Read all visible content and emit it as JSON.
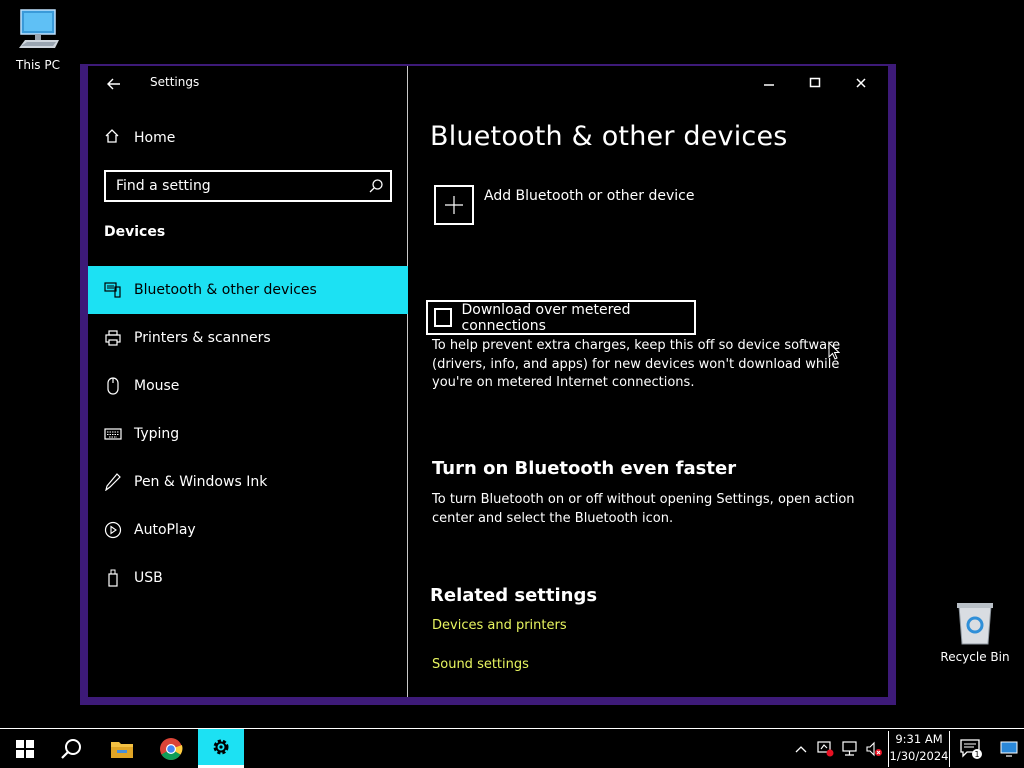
{
  "desktop": {
    "this_pc_label": "This PC",
    "recycle_bin_label": "Recycle Bin"
  },
  "window": {
    "title": "Settings",
    "back_icon": "back-arrow-icon",
    "controls": {
      "minimize": "minimize-icon",
      "maximize": "maximize-icon",
      "close": "close-icon"
    }
  },
  "sidebar": {
    "home_label": "Home",
    "search_placeholder": "Find a setting",
    "group_title": "Devices",
    "items": [
      {
        "label": "Bluetooth & other devices",
        "icon": "bluetooth-devices-icon",
        "active": true
      },
      {
        "label": "Printers & scanners",
        "icon": "printer-icon",
        "active": false
      },
      {
        "label": "Mouse",
        "icon": "mouse-icon",
        "active": false
      },
      {
        "label": "Typing",
        "icon": "keyboard-icon",
        "active": false
      },
      {
        "label": "Pen & Windows Ink",
        "icon": "pen-icon",
        "active": false
      },
      {
        "label": "AutoPlay",
        "icon": "autoplay-icon",
        "active": false
      },
      {
        "label": "USB",
        "icon": "usb-icon",
        "active": false
      }
    ]
  },
  "content": {
    "page_title": "Bluetooth & other devices",
    "add_device_label": "Add Bluetooth or other device",
    "metered": {
      "label": "Download over metered connections",
      "checked": false,
      "description": "To help prevent extra charges, keep this off so device software (drivers, info, and apps) for new devices won't download while you're on metered Internet connections."
    },
    "faster": {
      "title": "Turn on Bluetooth even faster",
      "description": "To turn Bluetooth on or off without opening Settings, open action center and select the Bluetooth icon."
    },
    "related": {
      "title": "Related settings",
      "links": [
        "Devices and printers",
        "Sound settings"
      ]
    }
  },
  "taskbar": {
    "time": "9:31 AM",
    "date": "1/30/2024",
    "notification_count": "1",
    "accent_color": "#1ce1f3",
    "link_color": "#e8f560"
  }
}
